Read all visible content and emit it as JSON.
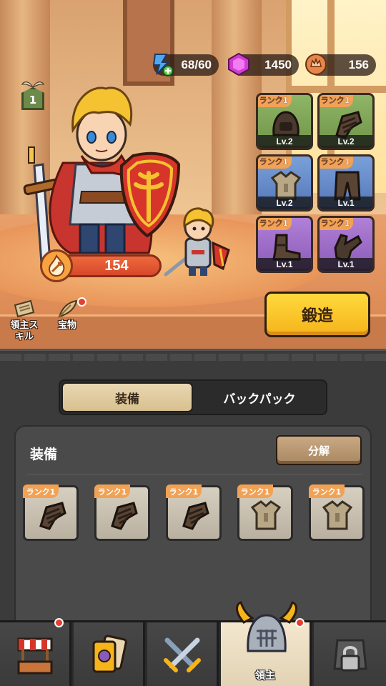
{
  "resources": {
    "energy": "68/60",
    "gems": "1450",
    "coins": "156"
  },
  "lord_level": "1",
  "power": "154",
  "equipped": [
    {
      "slot": "helmet",
      "rank": "ランク1",
      "level": "Lv.2",
      "rarity": "green"
    },
    {
      "slot": "gauntlet",
      "rank": "ランク1",
      "level": "Lv.2",
      "rarity": "green"
    },
    {
      "slot": "armor",
      "rank": "ランク1",
      "level": "Lv.2",
      "rarity": "blue"
    },
    {
      "slot": "pants",
      "rank": "ランク1",
      "level": "Lv.1",
      "rarity": "blue"
    },
    {
      "slot": "boots",
      "rank": "ランク1",
      "level": "Lv.1",
      "rarity": "purple"
    },
    {
      "slot": "gloves",
      "rank": "ランク1",
      "level": "Lv.1",
      "rarity": "purple"
    }
  ],
  "forge_button": "鍛造",
  "side_buttons": {
    "lord_skill": "領主ス\nキル",
    "treasure": "宝物"
  },
  "tabs": {
    "equipment": "装備",
    "backpack": "バックパック"
  },
  "inventory": {
    "title": "装備",
    "decompose_button": "分解",
    "items": [
      {
        "type": "gauntlet",
        "rank": "ランク1"
      },
      {
        "type": "gauntlet",
        "rank": "ランク1"
      },
      {
        "type": "gauntlet",
        "rank": "ランク1"
      },
      {
        "type": "armor",
        "rank": "ランク1"
      },
      {
        "type": "armor",
        "rank": "ランク1"
      }
    ]
  },
  "bottom_nav": {
    "shop": "",
    "cards": "",
    "battle": "",
    "lord": "領主",
    "locked": ""
  },
  "colors": {
    "forge": "#f5b41a",
    "notification": "#e44030",
    "rank_badge": "#f1a255"
  }
}
